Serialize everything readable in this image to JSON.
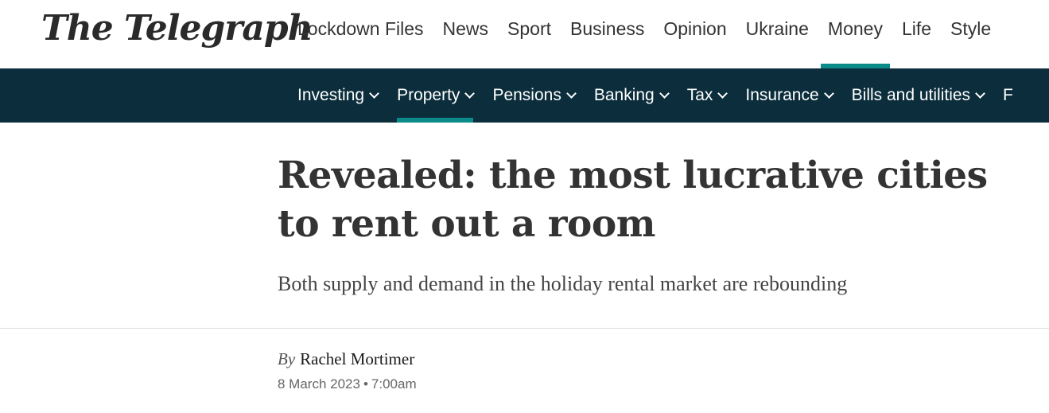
{
  "masthead": {
    "logo_text": "The Telegraph",
    "primary_nav": [
      {
        "label": "Lockdown Files",
        "active": false
      },
      {
        "label": "News",
        "active": false
      },
      {
        "label": "Sport",
        "active": false
      },
      {
        "label": "Business",
        "active": false
      },
      {
        "label": "Opinion",
        "active": false
      },
      {
        "label": "Ukraine",
        "active": false
      },
      {
        "label": "Money",
        "active": true
      },
      {
        "label": "Life",
        "active": false
      },
      {
        "label": "Style",
        "active": false
      }
    ]
  },
  "secondary_nav": [
    {
      "label": "Investing",
      "active": false
    },
    {
      "label": "Property",
      "active": true
    },
    {
      "label": "Pensions",
      "active": false
    },
    {
      "label": "Banking",
      "active": false
    },
    {
      "label": "Tax",
      "active": false
    },
    {
      "label": "Insurance",
      "active": false
    },
    {
      "label": "Bills and utilities",
      "active": false
    },
    {
      "label": "F",
      "active": false
    }
  ],
  "article": {
    "headline": "Revealed: the most lucrative cities to rent out a room",
    "standfirst": "Both supply and demand in the holiday rental market are rebounding",
    "byline_prefix": "By",
    "author": "Rachel Mortimer",
    "date": "8 March 2023",
    "separator": "•",
    "time": "7:00am"
  },
  "colors": {
    "accent": "#0b8a8a",
    "secondary_nav_bg": "#0b2d3c"
  }
}
